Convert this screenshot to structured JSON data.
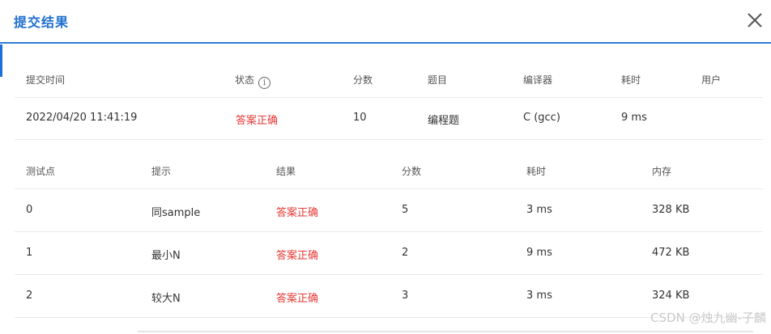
{
  "dialog": {
    "title": "提交结果"
  },
  "submission": {
    "headers": [
      "提交时间",
      "状态",
      "分数",
      "题目",
      "编译器",
      "耗时",
      "用户"
    ],
    "row": {
      "time": "2022/04/20 11:41:19",
      "status": "答案正确",
      "score": "10",
      "problem": "编程题",
      "compiler": "C (gcc)",
      "duration": "9 ms",
      "user": ""
    }
  },
  "testcases": {
    "headers": [
      "测试点",
      "提示",
      "结果",
      "分数",
      "耗时",
      "内存"
    ],
    "rows": [
      {
        "id": "0",
        "hint": "同sample",
        "result": "答案正确",
        "score": "5",
        "time": "3 ms",
        "memory": "328 KB"
      },
      {
        "id": "1",
        "hint": "最小N",
        "result": "答案正确",
        "score": "2",
        "time": "9 ms",
        "memory": "472 KB"
      },
      {
        "id": "2",
        "hint": "较大N",
        "result": "答案正确",
        "score": "3",
        "time": "3 ms",
        "memory": "324 KB"
      }
    ]
  },
  "watermark": "CSDN @烛九幽-子麟",
  "icons": {
    "close": "close-icon",
    "info": "info-icon"
  },
  "colors": {
    "accent": "#1f6fcf",
    "ok": "#e53935"
  }
}
